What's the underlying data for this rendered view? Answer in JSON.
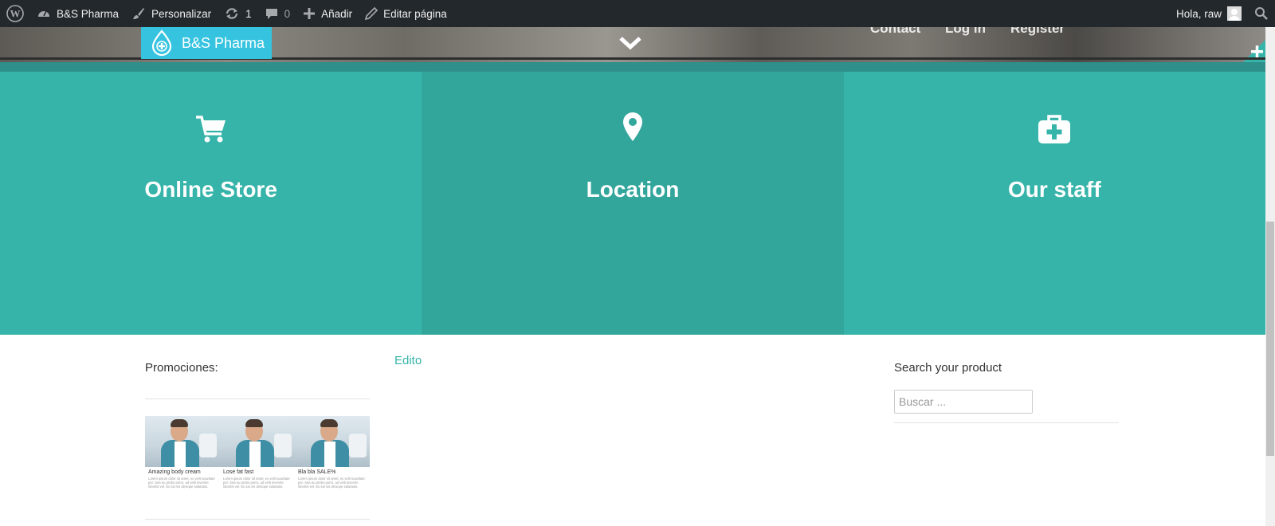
{
  "adminbar": {
    "site_name": "B&S Pharma",
    "customize": "Personalizar",
    "updates_count": "1",
    "comments_count": "0",
    "add_new": "Añadir",
    "edit_page": "Editar página",
    "greeting": "Hola, raw"
  },
  "header": {
    "brand": "B&S Pharma",
    "nav": [
      "Contact",
      "Log in",
      "Register"
    ]
  },
  "features": [
    {
      "title": "Online Store",
      "icon": "cart-icon"
    },
    {
      "title": "Location",
      "icon": "map-pin-icon"
    },
    {
      "title": "Our staff",
      "icon": "medkit-icon"
    }
  ],
  "promotions": {
    "title": "Promociones:",
    "cards": [
      {
        "title": "Amazing body cream",
        "text": "Lorem ipsum dolor sit amet, ex velit suavitate per. Sea eu probo porro, ad velit invenire lobortis vel. Eu ius vis denique salutatus."
      },
      {
        "title": "Lose fat fast",
        "text": "Lorem ipsum dolor sit amet, ex velit suavitate per. Sea eu probo porro, ad velit invenire lobortis vel. Eu ius vis denique salutatus."
      },
      {
        "title": "Bla bla SALE%",
        "text": "Lorem ipsum dolor sit amet, ex velit suavitate per. Sea eu probo porro, ad velit invenire lobortis vel. Eu ius vis denique salutatus."
      }
    ]
  },
  "edito": "Edito",
  "search": {
    "title": "Search your product",
    "placeholder": "Buscar ..."
  },
  "colors": {
    "adminbar": "#23282d",
    "teal": "#36b4a9",
    "teal_dark": "#33a69c",
    "logo_blue": "#35c3e0"
  }
}
